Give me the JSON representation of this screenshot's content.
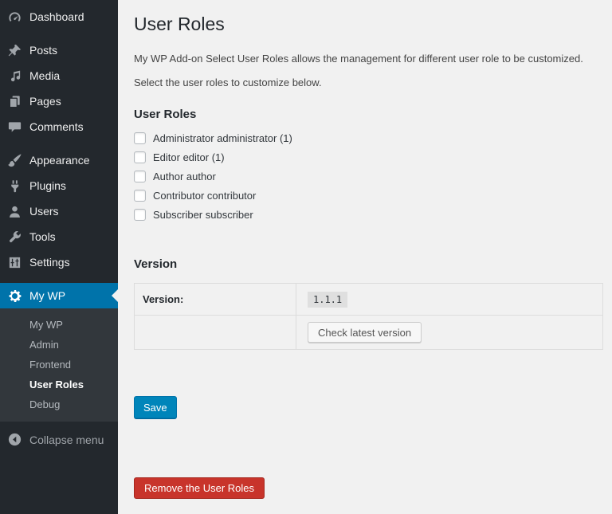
{
  "sidebar": {
    "items": [
      {
        "label": "Dashboard"
      },
      {
        "label": "Posts"
      },
      {
        "label": "Media"
      },
      {
        "label": "Pages"
      },
      {
        "label": "Comments"
      },
      {
        "label": "Appearance"
      },
      {
        "label": "Plugins"
      },
      {
        "label": "Users"
      },
      {
        "label": "Tools"
      },
      {
        "label": "Settings"
      },
      {
        "label": "My WP"
      }
    ],
    "active_item": "My WP",
    "submenu": {
      "items": [
        {
          "label": "My WP"
        },
        {
          "label": "Admin"
        },
        {
          "label": "Frontend"
        },
        {
          "label": "User Roles"
        },
        {
          "label": "Debug"
        }
      ],
      "current": "User Roles"
    },
    "collapse_label": "Collapse menu"
  },
  "main": {
    "title": "User Roles",
    "intro1": "My WP Add-on Select User Roles allows the management for different user role to be customized.",
    "intro2": "Select the user roles to customize below.",
    "roles": {
      "heading": "User Roles",
      "options": [
        {
          "label": "Administrator administrator (1)",
          "checked": false
        },
        {
          "label": "Editor editor (1)",
          "checked": false
        },
        {
          "label": "Author author",
          "checked": false
        },
        {
          "label": "Contributor contributor",
          "checked": false
        },
        {
          "label": "Subscriber subscriber",
          "checked": false
        }
      ]
    },
    "version": {
      "heading": "Version",
      "row_label": "Version:",
      "value": "1.1.1",
      "check_button": "Check latest version"
    },
    "save_label": "Save",
    "remove_label": "Remove the User Roles"
  },
  "colors": {
    "sidebar_bg": "#23282d",
    "submenu_bg": "#32373c",
    "menu_highlight": "#0073aa",
    "content_bg": "#f1f1f1",
    "primary_button": "#0085ba",
    "danger_button": "#c8342b"
  }
}
